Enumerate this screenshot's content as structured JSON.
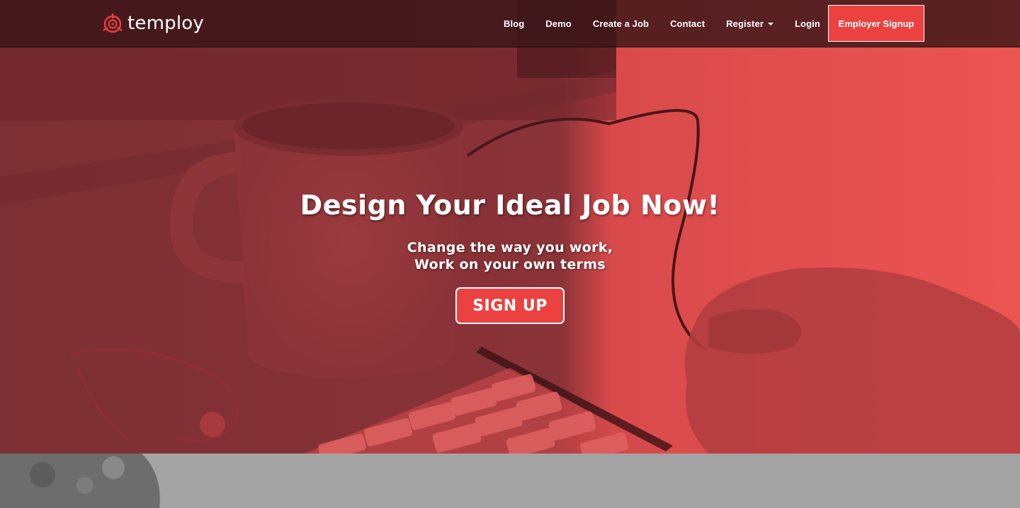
{
  "brand": {
    "name": "temploy",
    "logo_icon": "temploy-logo-icon",
    "accent_color": "#eb4140"
  },
  "nav": {
    "items": [
      {
        "label": "Blog"
      },
      {
        "label": "Demo"
      },
      {
        "label": "Create a Job"
      },
      {
        "label": "Contact"
      },
      {
        "label": "Register",
        "has_dropdown": true
      },
      {
        "label": "Login"
      }
    ],
    "cta_label": "Employer Signup"
  },
  "hero": {
    "title": "Design Your Ideal Job Now!",
    "subtitle_line1": "Change the way you work,",
    "subtitle_line2": "Work on your own terms",
    "cta_label": "SIGN UP",
    "overlay_color": "#e8504f"
  }
}
